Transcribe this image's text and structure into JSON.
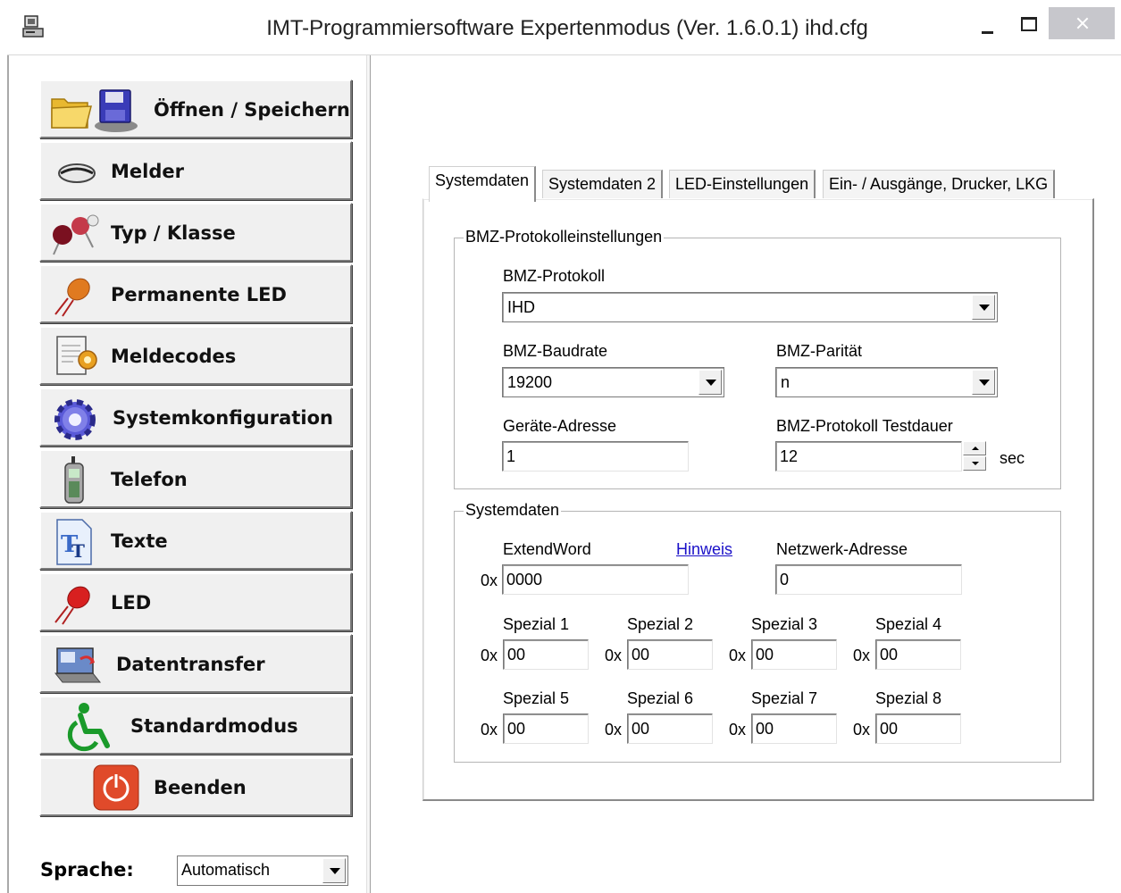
{
  "window": {
    "title": "IMT-Programmiersoftware Expertenmodus (Ver. 1.6.0.1) ihd.cfg"
  },
  "sidebar": {
    "buttons": [
      {
        "label": "Öffnen / Speichern",
        "icon": "folder-disk-icon"
      },
      {
        "label": "Melder",
        "icon": "detector-icon"
      },
      {
        "label": "Typ / Klasse",
        "icon": "components-icon"
      },
      {
        "label": "Permanente LED",
        "icon": "led-orange-icon"
      },
      {
        "label": "Meldecodes",
        "icon": "document-gear-icon"
      },
      {
        "label": "Systemkonfiguration",
        "icon": "gear-icon"
      },
      {
        "label": "Telefon",
        "icon": "mobile-phone-icon"
      },
      {
        "label": "Texte",
        "icon": "text-document-icon"
      },
      {
        "label": "LED",
        "icon": "led-red-icon"
      },
      {
        "label": "Datentransfer",
        "icon": "data-transfer-icon"
      },
      {
        "label": "Standardmodus",
        "icon": "wheelchair-icon"
      },
      {
        "label": "Beenden",
        "icon": "power-icon"
      }
    ],
    "language_label": "Sprache:",
    "language_value": "Automatisch"
  },
  "tabs": [
    {
      "label": "Systemdaten",
      "active": true
    },
    {
      "label": "Systemdaten 2",
      "active": false
    },
    {
      "label": "LED-Einstellungen",
      "active": false
    },
    {
      "label": "Ein- / Ausgänge, Drucker, LKG",
      "active": false
    }
  ],
  "bmz": {
    "group_title": "BMZ-Protokolleinstellungen",
    "protocol_label": "BMZ-Protokoll",
    "protocol_value": "IHD",
    "baudrate_label": "BMZ-Baudrate",
    "baudrate_value": "19200",
    "parity_label": "BMZ-Parität",
    "parity_value": "n",
    "address_label": "Geräte-Adresse",
    "address_value": "1",
    "testdauer_label": "BMZ-Protokoll Testdauer",
    "testdauer_value": "12",
    "testdauer_unit": "sec"
  },
  "systemdaten": {
    "group_title": "Systemdaten",
    "hex_prefix": "0x",
    "extendword_label": "ExtendWord",
    "extendword_value": "0000",
    "hinweis_link": "Hinweis",
    "netzwerk_label": "Netzwerk-Adresse",
    "netzwerk_value": "0",
    "spezial": [
      {
        "label": "Spezial 1",
        "value": "00"
      },
      {
        "label": "Spezial 2",
        "value": "00"
      },
      {
        "label": "Spezial 3",
        "value": "00"
      },
      {
        "label": "Spezial 4",
        "value": "00"
      },
      {
        "label": "Spezial 5",
        "value": "00"
      },
      {
        "label": "Spezial 6",
        "value": "00"
      },
      {
        "label": "Spezial 7",
        "value": "00"
      },
      {
        "label": "Spezial 8",
        "value": "00"
      }
    ]
  }
}
